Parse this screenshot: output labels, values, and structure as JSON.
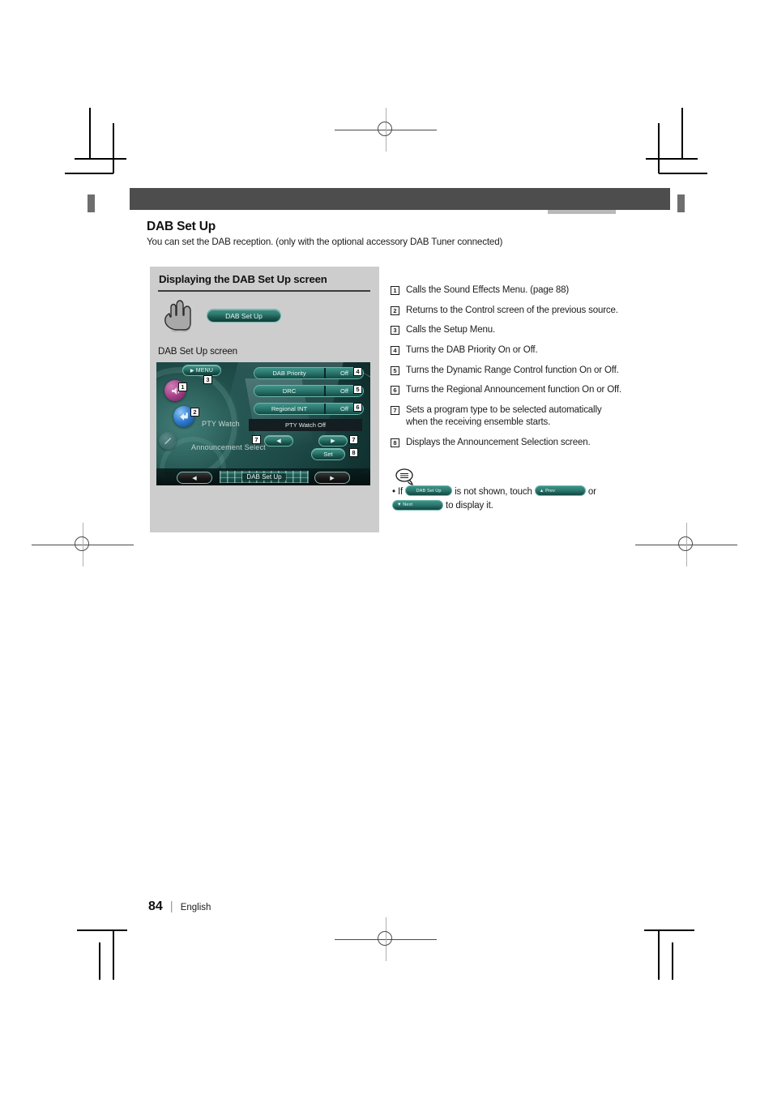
{
  "page": {
    "number": "84",
    "language": "English",
    "separator": "|"
  },
  "section": {
    "title": "DAB Set Up",
    "subtitle": "You can set the DAB reception. (only with the optional accessory DAB Tuner connected)"
  },
  "panel": {
    "heading": "Displaying the DAB Set Up screen",
    "touch_button_label": "DAB Set Up",
    "screen_caption": "DAB Set Up screen"
  },
  "device_screen": {
    "menu_button": "MENU",
    "settings": [
      {
        "label": "DAB Priority",
        "value": "Off",
        "callout": "4"
      },
      {
        "label": "DRC",
        "value": "Off",
        "callout": "5"
      },
      {
        "label": "Regional INT",
        "value": "Off",
        "callout": "6"
      }
    ],
    "pty_watch_label": "PTY Watch",
    "pty_watch_status": "PTY Watch Off",
    "announcement_select_label": "Announcement Select",
    "prev_arrow": "◀",
    "next_arrow": "▶",
    "set_button": "Set",
    "bottom_nav_left": "◀",
    "bottom_nav_right": "▶",
    "bottom_tab_label": "DAB Set Up",
    "callouts": {
      "sound_effects": "1",
      "return_source": "2",
      "setup_menu": "3",
      "pty_left": "7",
      "pty_right": "7",
      "set": "8"
    },
    "icons": {
      "sound_effects": "speaker-icon",
      "return": "return-home-icon",
      "dimmer": "dimmer-icon"
    }
  },
  "callout_list": [
    {
      "num": "1",
      "text": "Calls the Sound Effects Menu. (page 88)"
    },
    {
      "num": "2",
      "text": "Returns to the Control screen of the previous source."
    },
    {
      "num": "3",
      "text": "Calls the Setup Menu."
    },
    {
      "num": "4",
      "text": "Turns the DAB Priority On or Off."
    },
    {
      "num": "5",
      "text": "Turns the Dynamic Range Control function On or Off."
    },
    {
      "num": "6",
      "text": "Turns the Regional Announcement function On or Off."
    },
    {
      "num": "7",
      "text": "Sets a program type to be selected automatically when the receiving ensemble starts."
    },
    {
      "num": "8",
      "text": "Displays the Announcement Selection screen."
    }
  ],
  "note": {
    "icon": "note-balloon-icon",
    "bullet": "•",
    "text_if": "If",
    "button_dab_setup": "DAB Set Up",
    "text_not_shown": "is not shown, touch",
    "button_prev": "▲ Prev",
    "text_or": "or",
    "button_next": "▼ Next",
    "text_display": "to display it."
  },
  "colors": {
    "header_band": "#4d4d4d",
    "panel_bg": "#cdcdcd",
    "teal_button": "#2c7970",
    "teal_border": "#6fb7ac",
    "sound_icon": "#a8438b",
    "return_icon": "#2f7bd0"
  }
}
